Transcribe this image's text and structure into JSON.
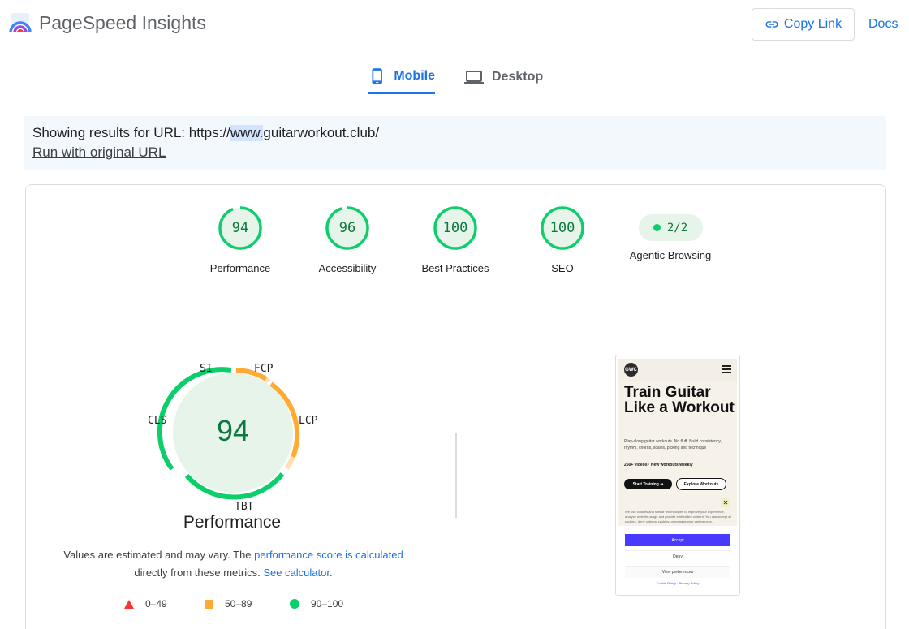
{
  "header": {
    "brand": "PageSpeed Insights",
    "copy_link": "Copy Link",
    "docs": "Docs"
  },
  "tabs": [
    {
      "label": "Mobile",
      "icon": "smartphone-icon",
      "active": true
    },
    {
      "label": "Desktop",
      "icon": "laptop-icon",
      "active": false
    }
  ],
  "url_banner": {
    "prefix": "Showing results for URL: https://",
    "highlight": "www.",
    "suffix": "guitarworkout.club/",
    "run_link": "Run with original URL"
  },
  "scores": [
    {
      "label": "Performance",
      "value": "94",
      "fraction": 0.94
    },
    {
      "label": "Accessibility",
      "value": "96",
      "fraction": 0.96
    },
    {
      "label": "Best Practices",
      "value": "100",
      "fraction": 1.0
    },
    {
      "label": "SEO",
      "value": "100",
      "fraction": 1.0
    }
  ],
  "agentic": {
    "label": "Agentic Browsing",
    "value": "2/2"
  },
  "performance_gauge": {
    "score": "94",
    "title": "Performance",
    "metrics": {
      "si": "SI",
      "fcp": "FCP",
      "lcp": "LCP",
      "tbt": "TBT",
      "cls": "CLS"
    }
  },
  "note": {
    "text1": "Values are estimated and may vary. The ",
    "link1": "performance score is calculated",
    "text2": "directly from these metrics. ",
    "link2": "See calculator",
    "text3": "."
  },
  "legend": [
    {
      "range": "0–49",
      "color": "#ff3333"
    },
    {
      "range": "50–89",
      "color": "#ffaa33"
    },
    {
      "range": "90–100",
      "color": "#0cce6b"
    }
  ],
  "preview": {
    "logo": "GWC",
    "title": "Train Guitar Like a Workout",
    "desc": "Play-along guitar workouts. No fluff. Build consistency, rhythm, chords, scales, picking and technique",
    "count": "250+ videos · New workouts weekly",
    "btn_start": "Start Training ➔",
    "btn_explore": "Explore Workouts",
    "cookie": "We use cookies and similar technologies to improve your experience, analyse website usage and provide embedded content. You can accept all cookies, deny optional cookies, or manage your preferences.",
    "accept": "Accept",
    "deny": "Deny",
    "prefs": "View preferences",
    "links": "Cookie Policy · Privacy Policy"
  },
  "colors": {
    "pass": "#0cce6b",
    "average": "#ffaa33",
    "fail": "#ff3333",
    "accent": "#1a73e8"
  }
}
